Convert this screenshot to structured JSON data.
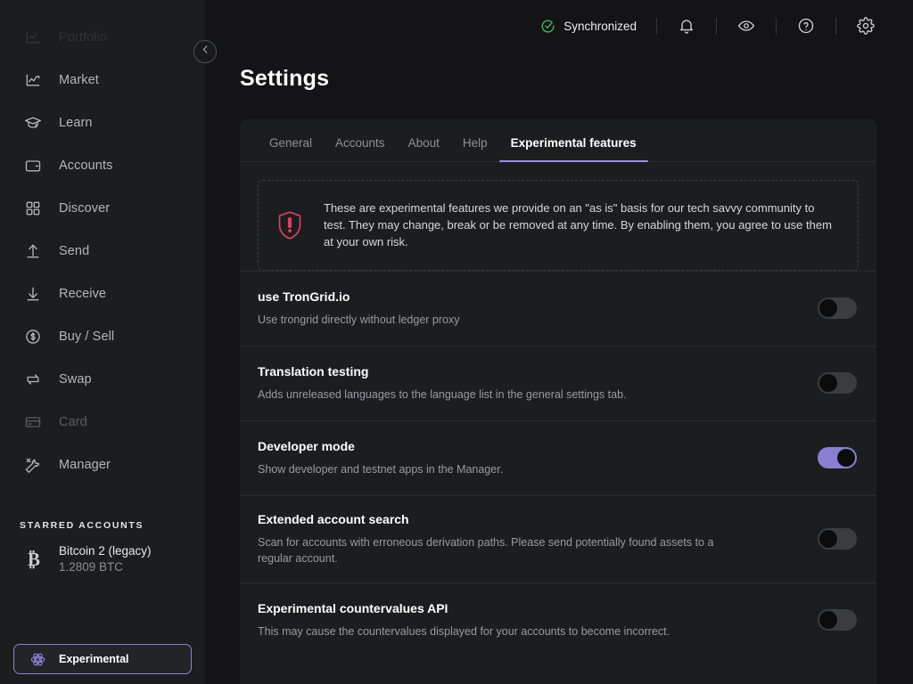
{
  "sidebar": {
    "nav": [
      {
        "label": "Portfolio",
        "icon": "chart-line-icon",
        "state": "ghost"
      },
      {
        "label": "Market",
        "icon": "market-chart-icon",
        "state": "normal"
      },
      {
        "label": "Learn",
        "icon": "graduation-cap-icon",
        "state": "normal"
      },
      {
        "label": "Accounts",
        "icon": "wallet-icon",
        "state": "normal"
      },
      {
        "label": "Discover",
        "icon": "grid-apps-icon",
        "state": "normal"
      },
      {
        "label": "Send",
        "icon": "arrow-up-send-icon",
        "state": "normal"
      },
      {
        "label": "Receive",
        "icon": "arrow-down-receive-icon",
        "state": "normal"
      },
      {
        "label": "Buy / Sell",
        "icon": "dollar-circle-icon",
        "state": "normal"
      },
      {
        "label": "Swap",
        "icon": "swap-arrows-icon",
        "state": "normal"
      },
      {
        "label": "Card",
        "icon": "credit-card-icon",
        "state": "dim"
      },
      {
        "label": "Manager",
        "icon": "wrench-screwdriver-icon",
        "state": "normal"
      }
    ],
    "starred_heading": "STARRED ACCOUNTS",
    "starred_accounts": [
      {
        "icon": "bitcoin-icon",
        "name": "Bitcoin 2 (legacy)",
        "balance": "1.2809 BTC"
      }
    ],
    "experimental_button": {
      "label": "Experimental",
      "icon": "atom-icon"
    },
    "collapse_button": {
      "icon": "chevron-left-icon"
    }
  },
  "topbar": {
    "sync_status": "Synchronized",
    "sync_icon": "check-circle-icon",
    "icons": [
      {
        "name": "bell-icon"
      },
      {
        "name": "eye-icon"
      },
      {
        "name": "help-circle-icon"
      },
      {
        "name": "gear-icon"
      }
    ]
  },
  "page": {
    "title": "Settings"
  },
  "tabs": [
    {
      "label": "General",
      "active": false
    },
    {
      "label": "Accounts",
      "active": false
    },
    {
      "label": "About",
      "active": false
    },
    {
      "label": "Help",
      "active": false
    },
    {
      "label": "Experimental features",
      "active": true
    }
  ],
  "banner": {
    "icon": "shield-alert-icon",
    "text": "These are experimental features we provide on an \"as is\" basis for our tech savvy community to test. They may change, break or be removed at any time. By enabling them, you agree to use them at your own risk."
  },
  "settings_rows": [
    {
      "title": "use TronGrid.io",
      "description": "Use trongrid directly without ledger proxy",
      "toggle": "off"
    },
    {
      "title": "Translation testing",
      "description": "Adds unreleased languages to the language list in the general settings tab.",
      "toggle": "off"
    },
    {
      "title": "Developer mode",
      "description": "Show developer and testnet apps in the Manager.",
      "toggle": "on"
    },
    {
      "title": "Extended account search",
      "description": "Scan for accounts with erroneous derivation paths. Please send potentially found assets to a regular account.",
      "toggle": "off"
    },
    {
      "title": "Experimental countervalues API",
      "description": "This may cause the countervalues displayed for your accounts to become incorrect.",
      "toggle": "off"
    }
  ],
  "colors": {
    "accent_purple": "#8b7fd4",
    "tab_underline": "#9b8ff0",
    "sync_green": "#3fbf6a",
    "banner_red": "#d9415f",
    "page_bg": "#141416",
    "panel_bg": "#1c1d1f"
  }
}
